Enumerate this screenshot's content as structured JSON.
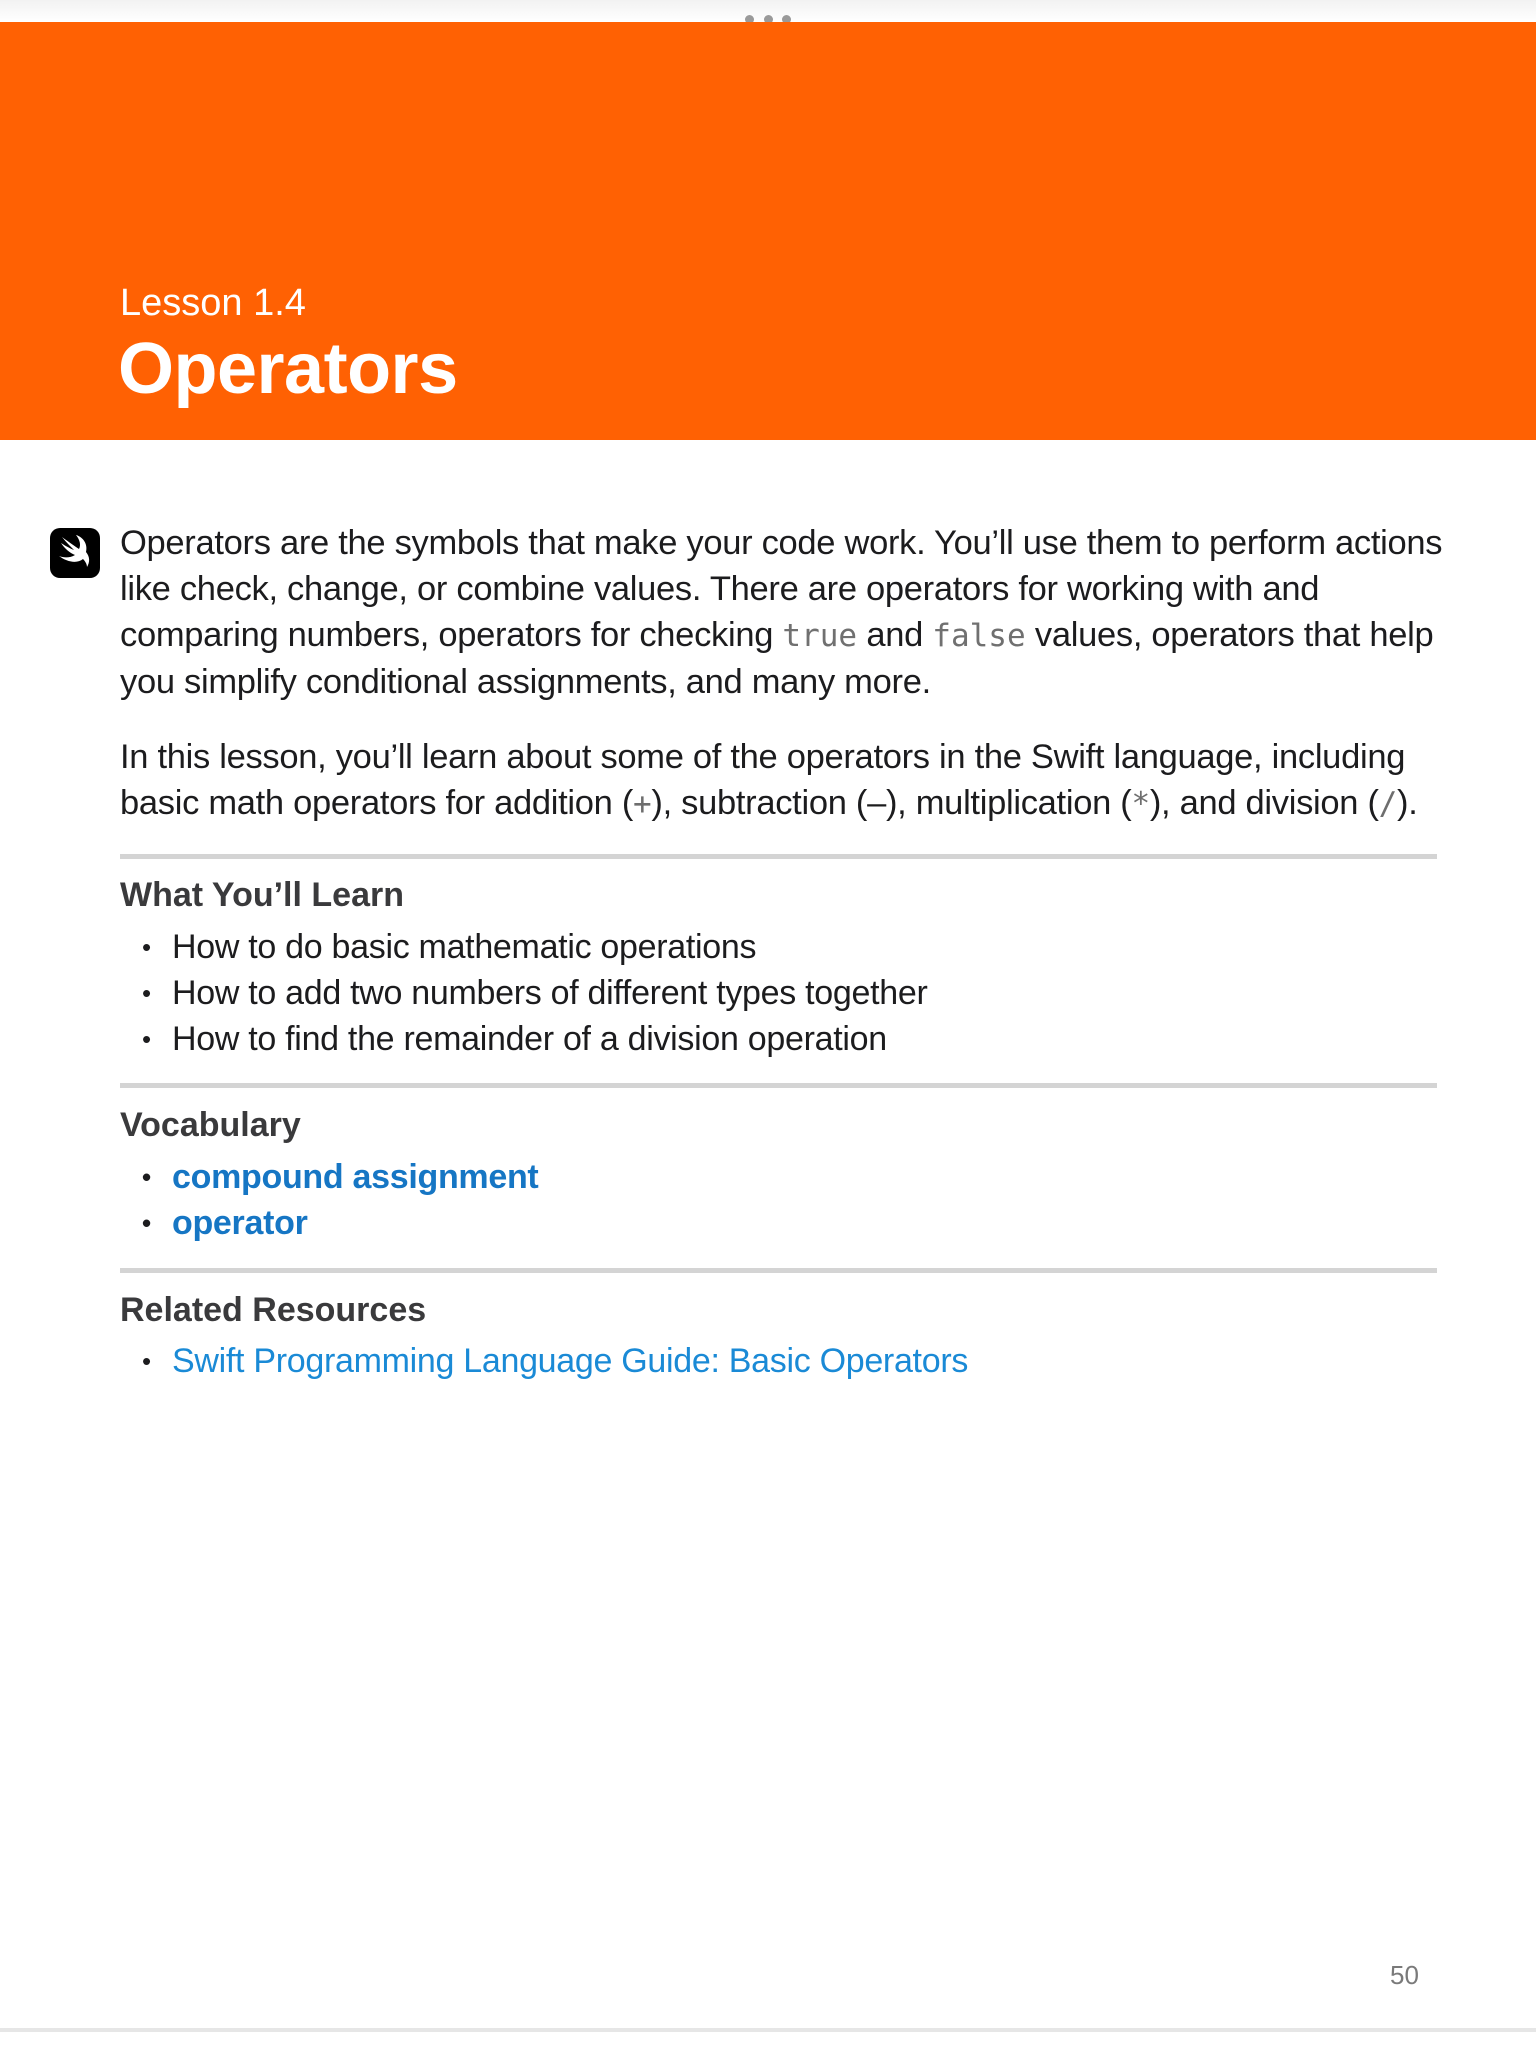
{
  "colors": {
    "banner": "#ff6103",
    "link": "#1676c4",
    "heading": "#3a3a3c"
  },
  "header": {
    "lesson_number": "Lesson 1.4",
    "title": "Operators"
  },
  "intro": {
    "p1_part1": "Operators are the symbols that make your code work. You’ll use them to perform actions like check, change, or combine values. There are operators for working with and comparing numbers, operators for checking ",
    "p1_code1": "true",
    "p1_part2": " and ",
    "p1_code2": "false",
    "p1_part3": " values, operators that help you simplify conditional assignments, and many more.",
    "p2_part1": "In this lesson, you’ll learn about some of the operators in the Swift language, including basic math operators for addition (",
    "p2_op_add": "+",
    "p2_part2": "), subtraction (",
    "p2_op_sub": "–",
    "p2_part3": "), multiplication (",
    "p2_op_mul": "*",
    "p2_part4": "), and division (",
    "p2_op_div": "/",
    "p2_part5": ")."
  },
  "sections": {
    "learn": {
      "heading": "What You’ll Learn",
      "items": [
        "How to do basic mathematic operations",
        "How to add two numbers of different types together",
        "How to find the remainder of a division operation"
      ]
    },
    "vocabulary": {
      "heading": "Vocabulary",
      "items": [
        "compound assignment",
        "operator"
      ]
    },
    "resources": {
      "heading": "Related Resources",
      "items": [
        "Swift Programming Language Guide: Basic Operators"
      ]
    }
  },
  "footer": {
    "page_number": "50"
  },
  "icons": {
    "logo": "swift-logo-icon",
    "handle": "drag-handle-icon"
  }
}
